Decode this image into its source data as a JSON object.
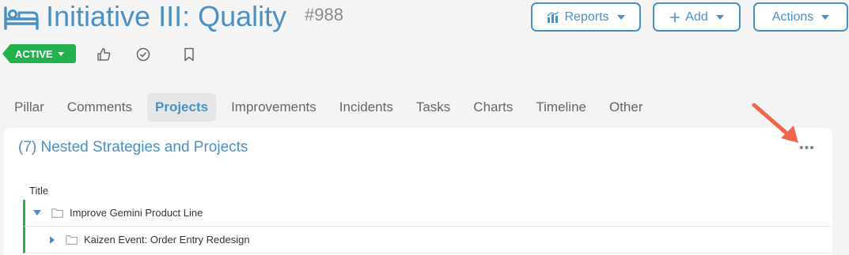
{
  "header": {
    "title": "Initiative III: Quality",
    "id_label": "#988",
    "icon": "bed-icon",
    "buttons": {
      "reports": "Reports",
      "add": "Add",
      "actions": "Actions"
    }
  },
  "status": {
    "label": "ACTIVE",
    "color": "#22b14c"
  },
  "toolbar_icons": [
    "thumbs-up-icon",
    "check-circle-icon",
    "bookmark-icon"
  ],
  "tabs": [
    {
      "label": "Pillar"
    },
    {
      "label": "Comments"
    },
    {
      "label": "Projects",
      "active": true
    },
    {
      "label": "Improvements"
    },
    {
      "label": "Incidents"
    },
    {
      "label": "Tasks"
    },
    {
      "label": "Charts"
    },
    {
      "label": "Timeline"
    },
    {
      "label": "Other"
    }
  ],
  "panel": {
    "title": "(7) Nested Strategies and Projects",
    "more_label": "•••",
    "column_header": "Title",
    "rows": [
      {
        "label": "Improve Gemini Product Line",
        "expanded": true
      },
      {
        "label": "Kaizen Event: Order Entry Redesign",
        "expanded": false
      }
    ]
  },
  "colors": {
    "accent": "#4a90c2",
    "status": "#22b14c",
    "annotation_arrow": "#f0654a"
  }
}
